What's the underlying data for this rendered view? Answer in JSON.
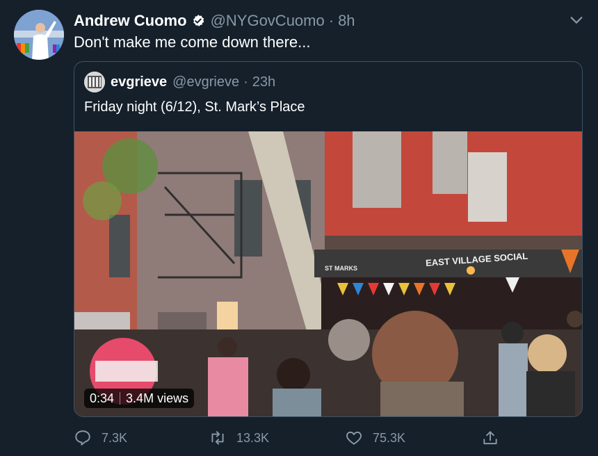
{
  "tweet": {
    "author_name": "Andrew Cuomo",
    "handle": "@NYGovCuomo",
    "separator": "·",
    "time": "8h",
    "text": "Don't make me come down there..."
  },
  "quoted_tweet": {
    "author_name": "evgrieve",
    "handle": "@evgrieve",
    "separator": "·",
    "time": "23h",
    "text": "Friday night (6/12), St. Mark’s Place",
    "video": {
      "duration": "0:34",
      "views": "3.4M views",
      "sign_text": "EAST VILLAGE SOCIAL",
      "sign_text_2": "ST MARKS"
    }
  },
  "actions": {
    "replies": "7.3K",
    "retweets": "13.3K",
    "likes": "75.3K"
  },
  "colors": {
    "background": "#15202b",
    "secondary_text": "#8899a6",
    "verified": "#1da1f2",
    "border": "#3d5466"
  },
  "icons": [
    "verified-badge-icon",
    "chevron-down-icon",
    "reply-icon",
    "retweet-icon",
    "like-icon",
    "share-icon"
  ]
}
